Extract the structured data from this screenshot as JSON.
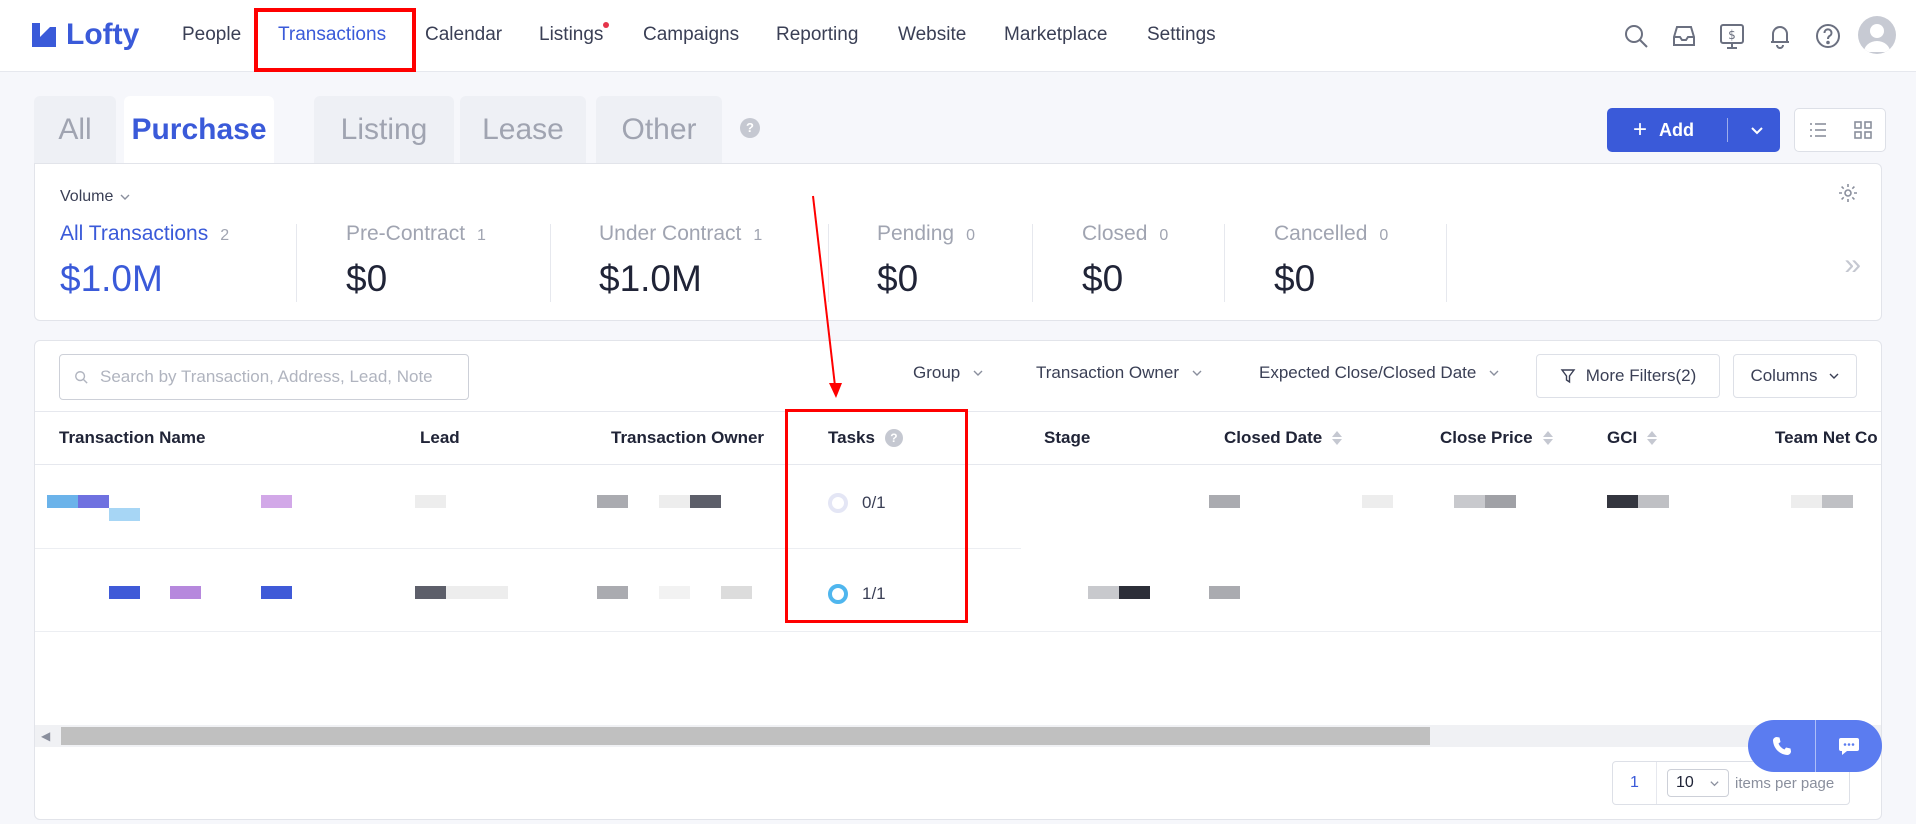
{
  "app": {
    "name": "Lofty"
  },
  "nav": {
    "items": [
      "People",
      "Transactions",
      "Calendar",
      "Listings",
      "Campaigns",
      "Reporting",
      "Website",
      "Marketplace",
      "Settings"
    ],
    "active": "Transactions"
  },
  "tabs": {
    "items": [
      "All",
      "Purchase",
      "Listing",
      "Lease",
      "Other"
    ],
    "active": "Purchase",
    "help": "?"
  },
  "actions": {
    "add_label": "Add",
    "add_plus": "+"
  },
  "summary": {
    "volume_label": "Volume",
    "stats": [
      {
        "title": "All Transactions",
        "count": "2",
        "value": "$1.0M"
      },
      {
        "title": "Pre-Contract",
        "count": "1",
        "value": "$0"
      },
      {
        "title": "Under Contract",
        "count": "1",
        "value": "$1.0M"
      },
      {
        "title": "Pending",
        "count": "0",
        "value": "$0"
      },
      {
        "title": "Closed",
        "count": "0",
        "value": "$0"
      },
      {
        "title": "Cancelled",
        "count": "0",
        "value": "$0"
      }
    ],
    "more": "»"
  },
  "filters": {
    "search_placeholder": "Search by Transaction, Address, Lead, Note",
    "group": "Group",
    "owner": "Transaction Owner",
    "date": "Expected Close/Closed Date",
    "more_filters": "More Filters(2)",
    "columns": "Columns"
  },
  "table": {
    "headers": [
      "Transaction Name",
      "Lead",
      "Transaction Owner",
      "Tasks",
      "Stage",
      "Closed Date",
      "Close Price",
      "GCI",
      "Team Net Co"
    ],
    "rows": [
      {
        "tasks": "0/1",
        "tasks_done": 0
      },
      {
        "tasks": "1/1",
        "tasks_done": 1
      }
    ]
  },
  "pagination": {
    "page": "1",
    "per_page": "10",
    "per_page_label": "items per page"
  },
  "colors": {
    "accent": "#3a5ad9",
    "annotation": "#ff0000",
    "task_ring_done": "#4fb6ee"
  }
}
